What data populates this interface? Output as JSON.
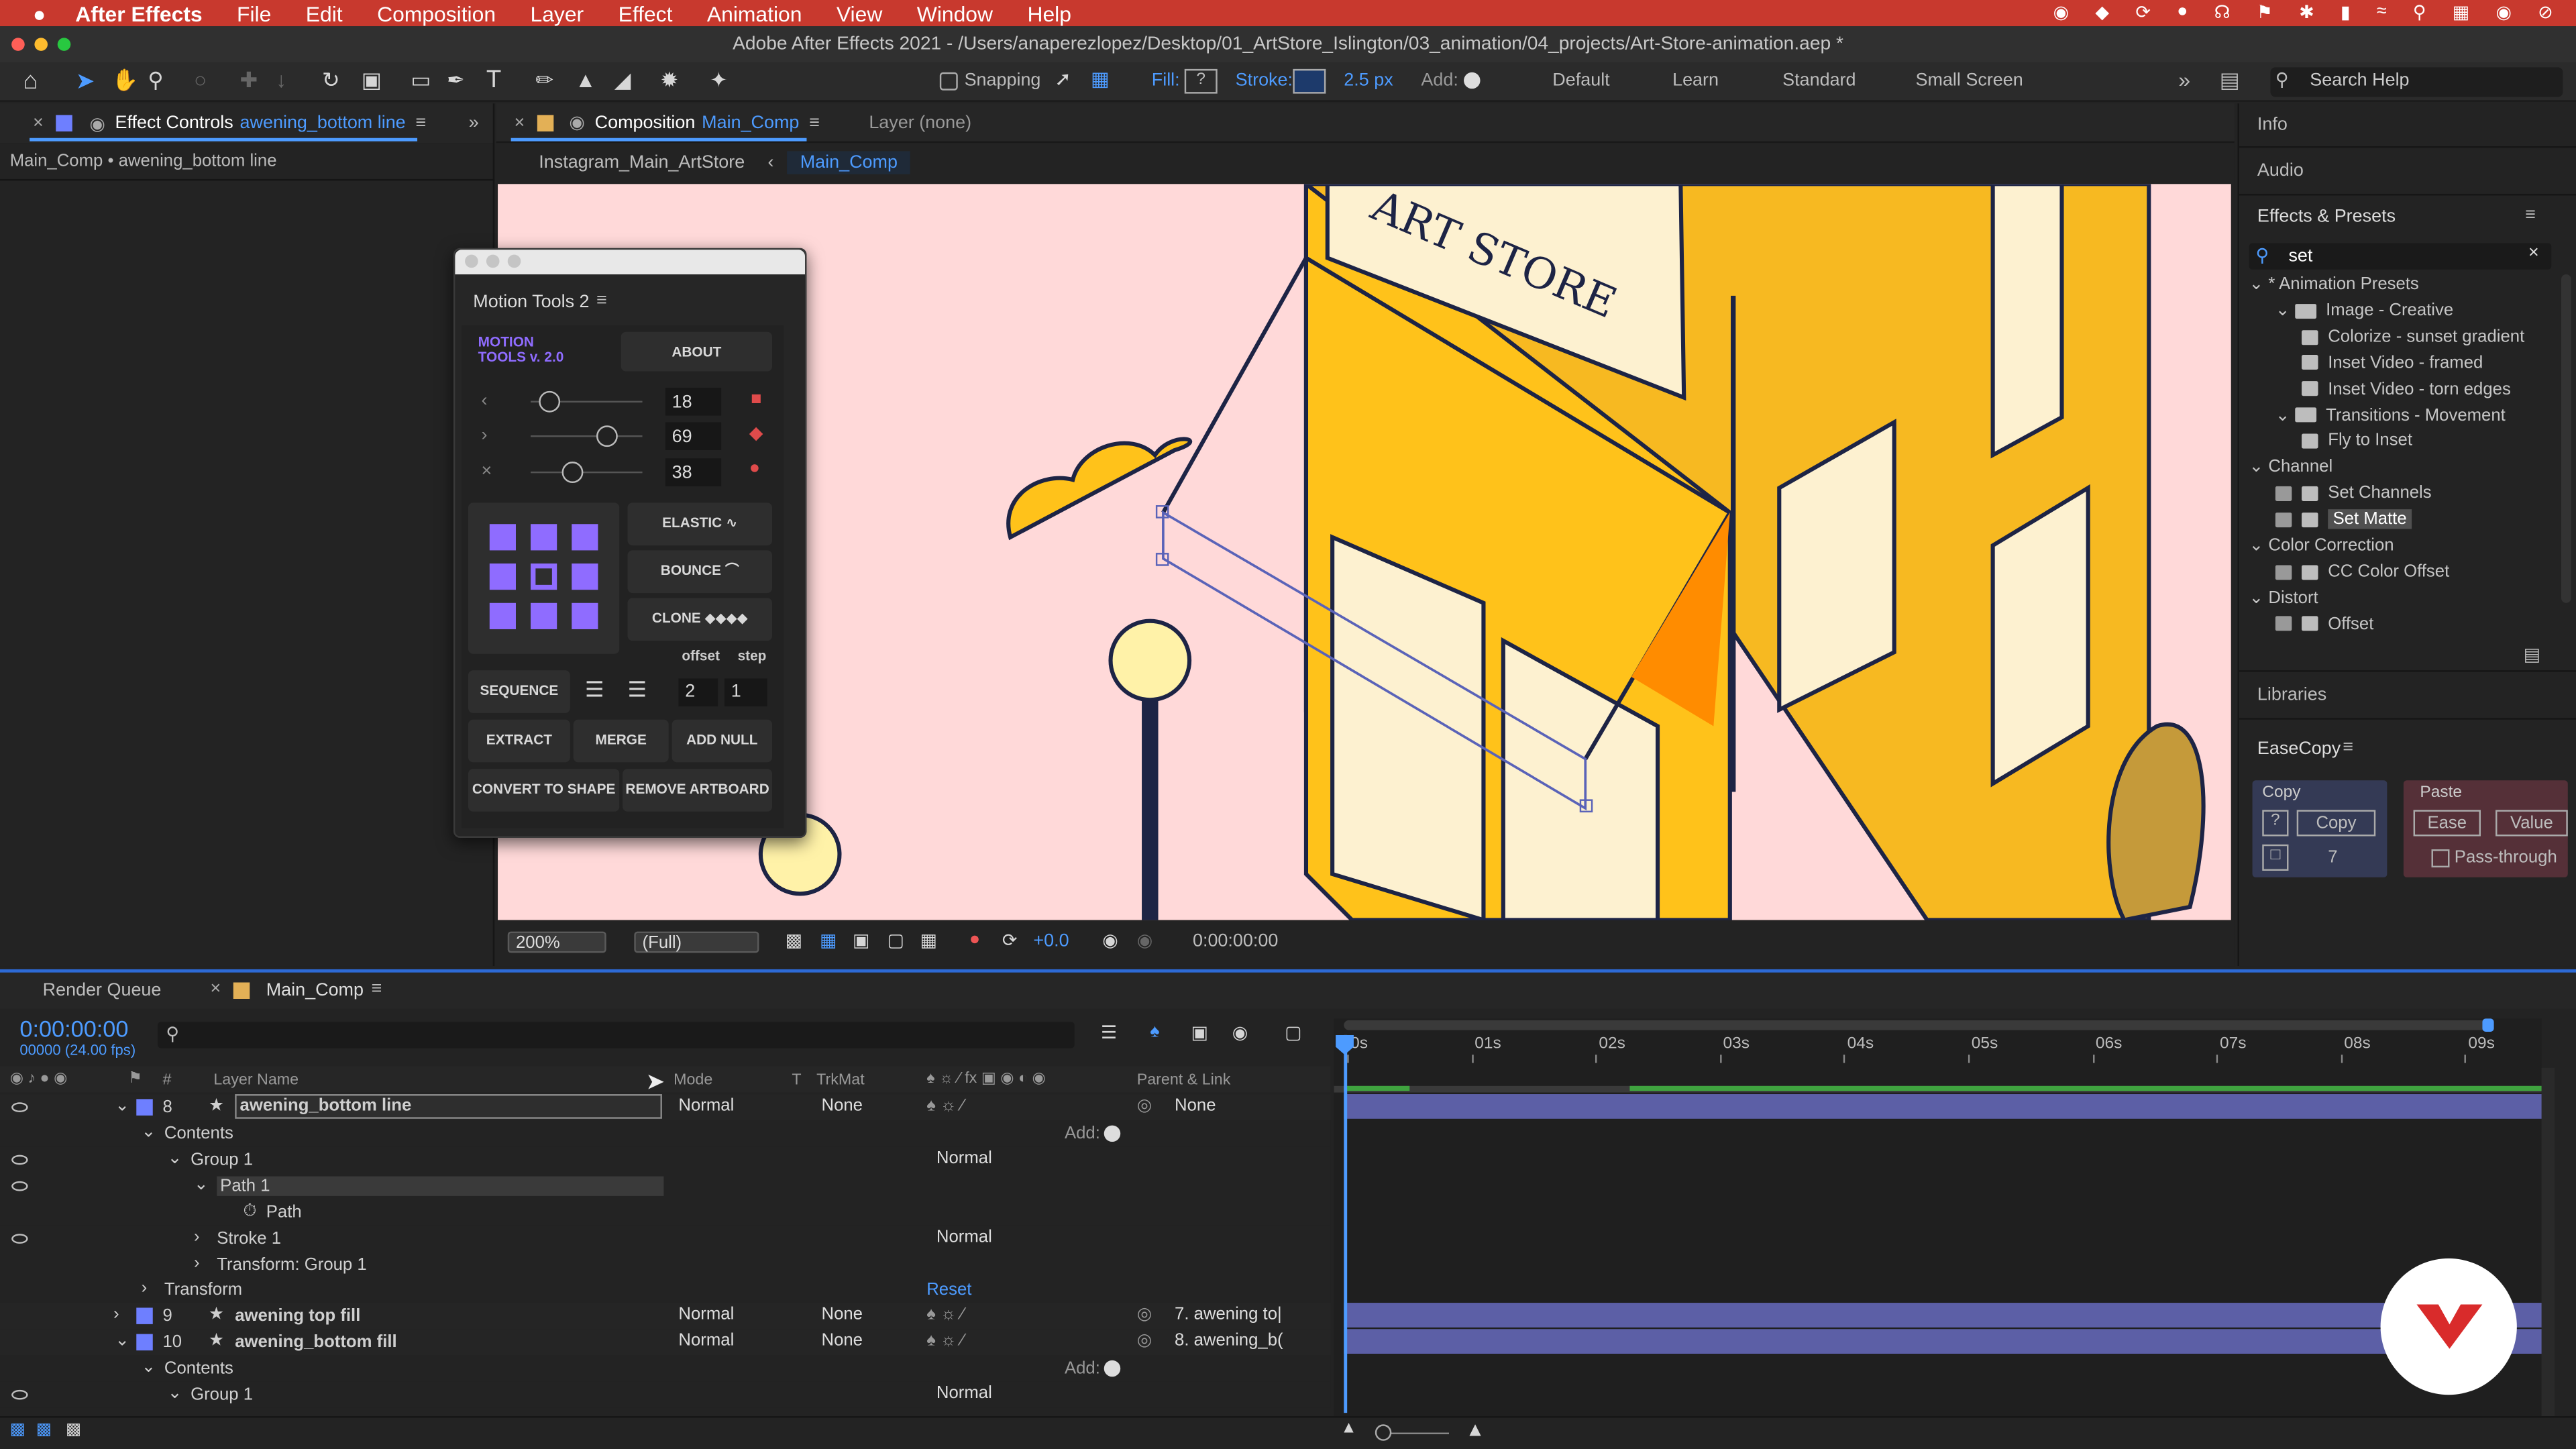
{
  "menubar": {
    "app": "After Effects",
    "items": [
      "File",
      "Edit",
      "Composition",
      "Layer",
      "Effect",
      "Animation",
      "View",
      "Window",
      "Help"
    ]
  },
  "titlebar": {
    "title": "Adobe After Effects 2021 - /Users/anaperezlopez/Desktop/01_ArtStore_Islington/03_animation/04_projects/Art-Store-animation.aep *"
  },
  "toolbar": {
    "snapping": "Snapping",
    "fill": "Fill:",
    "fill_val": "?",
    "stroke": "Stroke:",
    "stroke_px": "2.5 px",
    "add": "Add:",
    "workspaces": [
      "Default",
      "Learn",
      "Standard",
      "Small Screen"
    ],
    "search": "Search Help"
  },
  "effect_controls": {
    "tab": "Effect Controls",
    "layer": "awening_bottom line",
    "crumb": "Main_Comp • awening_bottom line"
  },
  "composition": {
    "tab": "Composition",
    "comp": "Main_Comp",
    "layer_tab": "Layer (none)",
    "crumb_parent": "Instagram_Main_ArtStore",
    "crumb_current": "Main_Comp",
    "zoom": "200%",
    "quality": "(Full)",
    "exposure": "+0.0",
    "timecode": "0:00:00:00",
    "sign_text": "ART STORE"
  },
  "motion_tools": {
    "title": "Motion Tools 2",
    "logo_line1": "MOTION",
    "logo_line2": "TOOLS v. 2.0",
    "about": "ABOUT",
    "sliders": [
      {
        "value": "18"
      },
      {
        "value": "69"
      },
      {
        "value": "38"
      }
    ],
    "elastic": "ELASTIC",
    "bounce": "BOUNCE",
    "clone": "CLONE",
    "offset": "offset",
    "step": "step",
    "sequence": "SEQUENCE",
    "seq_a": "2",
    "seq_b": "1",
    "extract": "EXTRACT",
    "merge": "MERGE",
    "add_null": "ADD NULL",
    "convert": "CONVERT TO SHAPE",
    "remove": "REMOVE ARTBOARD"
  },
  "right_panel": {
    "info": "Info",
    "audio": "Audio",
    "effects_presets": "Effects & Presets",
    "search_value": "set",
    "tree": [
      {
        "label": "* Animation Presets",
        "indent": 0,
        "type": "folder"
      },
      {
        "label": "Image - Creative",
        "indent": 1,
        "type": "folder"
      },
      {
        "label": "Colorize - sunset gradient",
        "indent": 2,
        "type": "file"
      },
      {
        "label": "Inset Video - framed",
        "indent": 2,
        "type": "file"
      },
      {
        "label": "Inset Video - torn edges",
        "indent": 2,
        "type": "file"
      },
      {
        "label": "Transitions - Movement",
        "indent": 1,
        "type": "folder"
      },
      {
        "label": "Fly to Inset",
        "indent": 2,
        "type": "file"
      },
      {
        "label": "Channel",
        "indent": 0,
        "type": "folder"
      },
      {
        "label": "Set Channels",
        "indent": 1,
        "type": "fx"
      },
      {
        "label": "Set Matte",
        "indent": 1,
        "type": "fx",
        "selected": true
      },
      {
        "label": "Color Correction",
        "indent": 0,
        "type": "folder"
      },
      {
        "label": "CC Color Offset",
        "indent": 1,
        "type": "fx"
      },
      {
        "label": "Distort",
        "indent": 0,
        "type": "folder"
      },
      {
        "label": "Offset",
        "indent": 1,
        "type": "fx"
      }
    ],
    "libraries": "Libraries",
    "easecopy": "EaseCopy",
    "copy_title": "Copy",
    "copy_btn": "Copy",
    "copy_q": "?",
    "copy_num": "7",
    "paste_title": "Paste",
    "ease_btn": "Ease",
    "value_btn": "Value",
    "pass_through": "Pass-through"
  },
  "timeline": {
    "render_queue": "Render Queue",
    "comp_tab": "Main_Comp",
    "time": "0:00:00:00",
    "frames": "00000 (24.00 fps)",
    "col": {
      "num": "#",
      "name": "Layer Name",
      "mode": "Mode",
      "t": "T",
      "trkmat": "TrkMat",
      "parent": "Parent & Link"
    },
    "ruler": [
      "0s",
      "01s",
      "02s",
      "03s",
      "04s",
      "05s",
      "06s",
      "07s",
      "08s",
      "09s"
    ],
    "rows": [
      {
        "num": "8",
        "name": "awening_bottom line",
        "mode": "Normal",
        "trk": "None",
        "parent": "None"
      },
      {
        "label": "Contents",
        "add": "Add:"
      },
      {
        "label": "Group 1",
        "mode": "Normal"
      },
      {
        "label": "Path 1"
      },
      {
        "label": "Path"
      },
      {
        "label": "Stroke 1",
        "mode": "Normal"
      },
      {
        "label": "Transform: Group 1"
      },
      {
        "label": "Transform",
        "reset": "Reset"
      },
      {
        "num": "9",
        "name": "awening top fill",
        "mode": "Normal",
        "trk": "None",
        "parent": "7. awening to|"
      },
      {
        "num": "10",
        "name": "awening_bottom fill",
        "mode": "Normal",
        "trk": "None",
        "parent": "8. awening_b("
      },
      {
        "label": "Contents",
        "add": "Add:"
      },
      {
        "label": "Group 1",
        "mode": "Normal"
      }
    ]
  }
}
